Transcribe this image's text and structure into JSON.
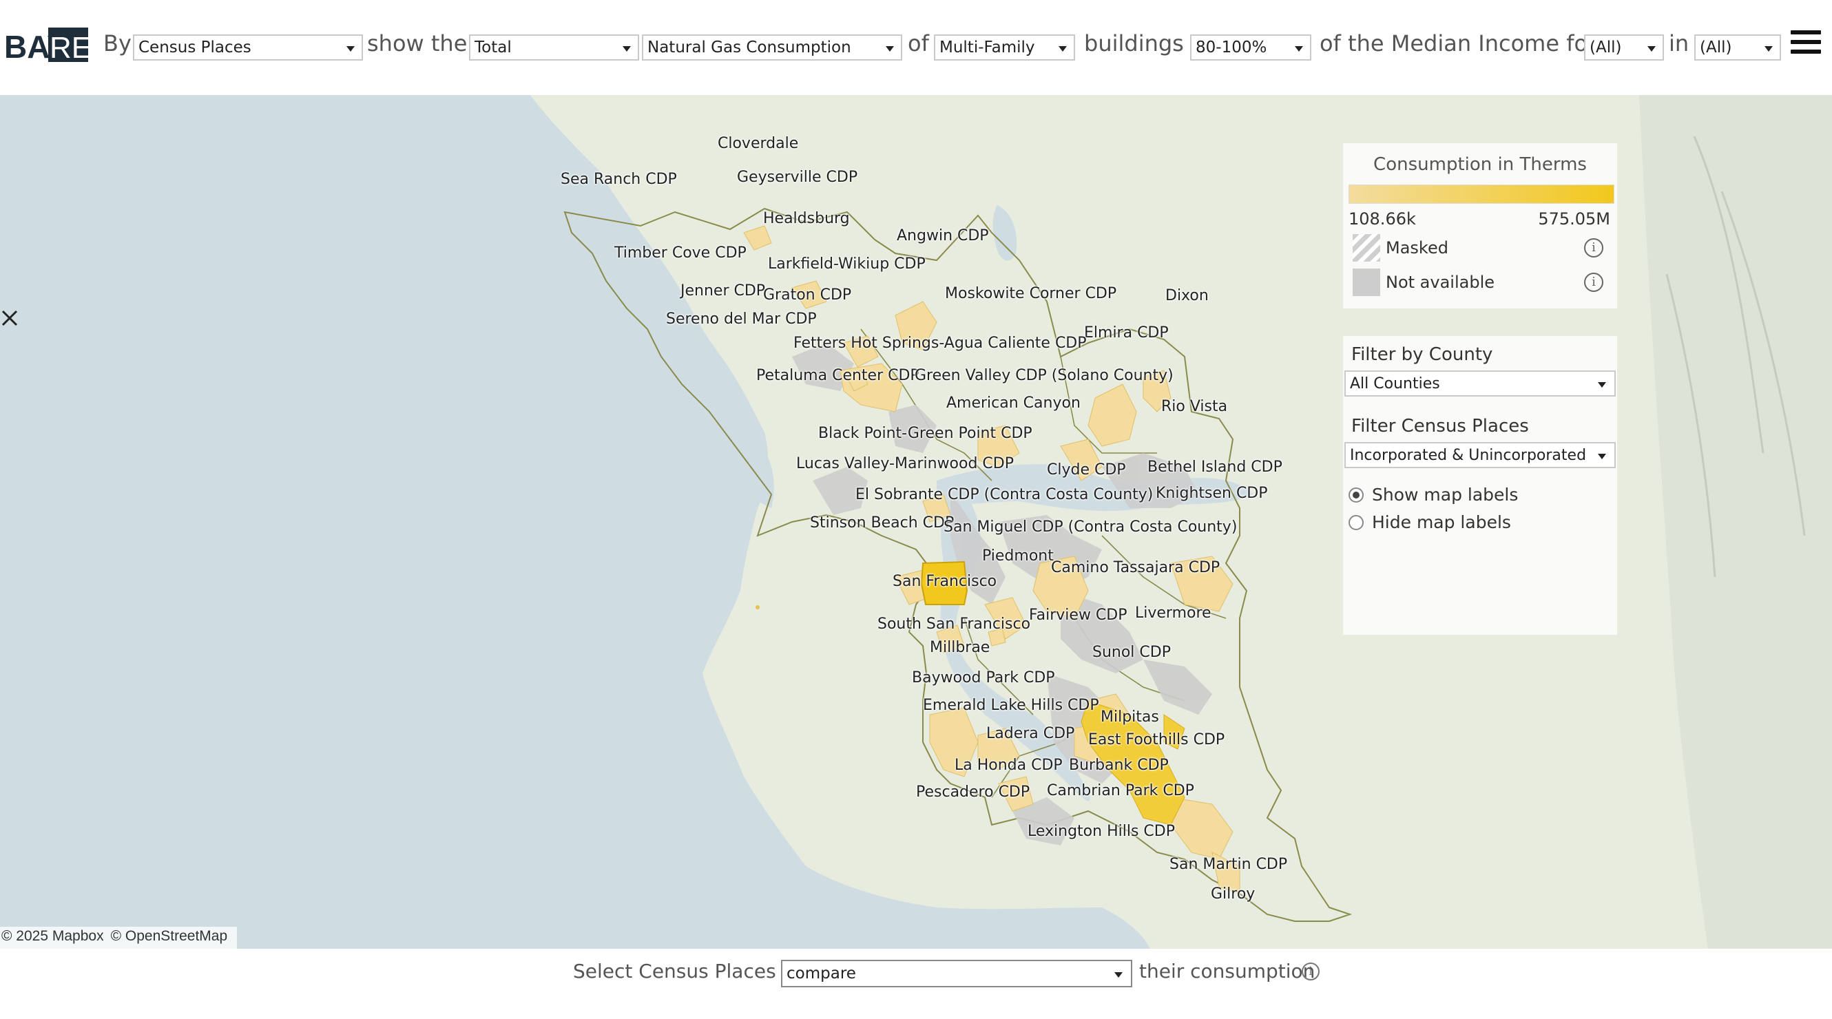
{
  "brand": {
    "logo_text": "BAYREN",
    "logo_bay": "BAY",
    "logo_ren": "REN"
  },
  "toolbar": {
    "by_label": "By",
    "geography": "Census Places",
    "show_label": "show the",
    "measure": "Total",
    "metric": "Natural Gas Consumption",
    "of_label": "of",
    "building_type": "Multi-Family",
    "buildings_label": "buildings",
    "income_range": "80-100%",
    "median_label": "of the Median Income for",
    "income_area": "(All)",
    "in_label": "in",
    "region": "(All)",
    "menu_icon": "hamburger-menu-icon"
  },
  "legend": {
    "title": "Consumption in Therms",
    "min": "108.66k",
    "max": "575.05M",
    "gradient_start": "#f3dc9e",
    "gradient_end": "#f2c81d",
    "masked_label": "Masked",
    "na_label": "Not available"
  },
  "filters": {
    "county_title": "Filter by County",
    "county_value": "All Counties",
    "places_title": "Filter Census Places",
    "places_value": "Incorporated & Unincorporated",
    "show_labels": "Show map labels",
    "hide_labels": "Hide map labels",
    "selected": "show"
  },
  "map": {
    "attribution": [
      "© 2025 Mapbox",
      "© OpenStreetMap"
    ],
    "places": [
      {
        "name": "Cloverdale"
      },
      {
        "name": "Sea Ranch CDP"
      },
      {
        "name": "Geyserville CDP"
      },
      {
        "name": "Healdsburg"
      },
      {
        "name": "Angwin CDP"
      },
      {
        "name": "Timber Cove CDP"
      },
      {
        "name": "Larkfield-Wikiup CDP"
      },
      {
        "name": "Jenner CDP"
      },
      {
        "name": "Graton CDP"
      },
      {
        "name": "Moskowite Corner CDP"
      },
      {
        "name": "Dixon"
      },
      {
        "name": "Sereno del Mar CDP"
      },
      {
        "name": "Elmira CDP"
      },
      {
        "name": "Fetters Hot Springs-Agua Caliente CDP"
      },
      {
        "name": "Petaluma Center CDP"
      },
      {
        "name": "Green Valley CDP (Solano County)"
      },
      {
        "name": "American Canyon"
      },
      {
        "name": "Rio Vista"
      },
      {
        "name": "Black Point-Green Point CDP"
      },
      {
        "name": "Lucas Valley-Marinwood CDP"
      },
      {
        "name": "Clyde CDP"
      },
      {
        "name": "Bethel Island CDP"
      },
      {
        "name": "El Sobrante CDP (Contra Costa County)"
      },
      {
        "name": "Knightsen CDP"
      },
      {
        "name": "Stinson Beach CDP"
      },
      {
        "name": "San Miguel CDP (Contra Costa County)"
      },
      {
        "name": "Piedmont"
      },
      {
        "name": "Camino Tassajara CDP"
      },
      {
        "name": "San Francisco"
      },
      {
        "name": "Fairview CDP"
      },
      {
        "name": "Livermore"
      },
      {
        "name": "South San Francisco"
      },
      {
        "name": "Millbrae"
      },
      {
        "name": "Sunol CDP"
      },
      {
        "name": "Baywood Park CDP"
      },
      {
        "name": "Emerald Lake Hills CDP"
      },
      {
        "name": "Milpitas"
      },
      {
        "name": "Ladera CDP"
      },
      {
        "name": "East Foothills CDP"
      },
      {
        "name": "La Honda CDP"
      },
      {
        "name": "Burbank CDP"
      },
      {
        "name": "Pescadero CDP"
      },
      {
        "name": "Cambrian Park CDP"
      },
      {
        "name": "Lexington Hills CDP"
      },
      {
        "name": "San Martin CDP"
      },
      {
        "name": "Gilroy"
      }
    ]
  },
  "bottom": {
    "prefix": "Select Census Places to",
    "action": "compare",
    "suffix": "their consumption"
  },
  "colors": {
    "water": "#cfdde3",
    "land": "#e7ecdf",
    "consumption_high": "#f2c81d",
    "consumption_low": "#f3dc9e",
    "not_available": "#cdcdcd",
    "county_border": "#8a8a4a"
  }
}
